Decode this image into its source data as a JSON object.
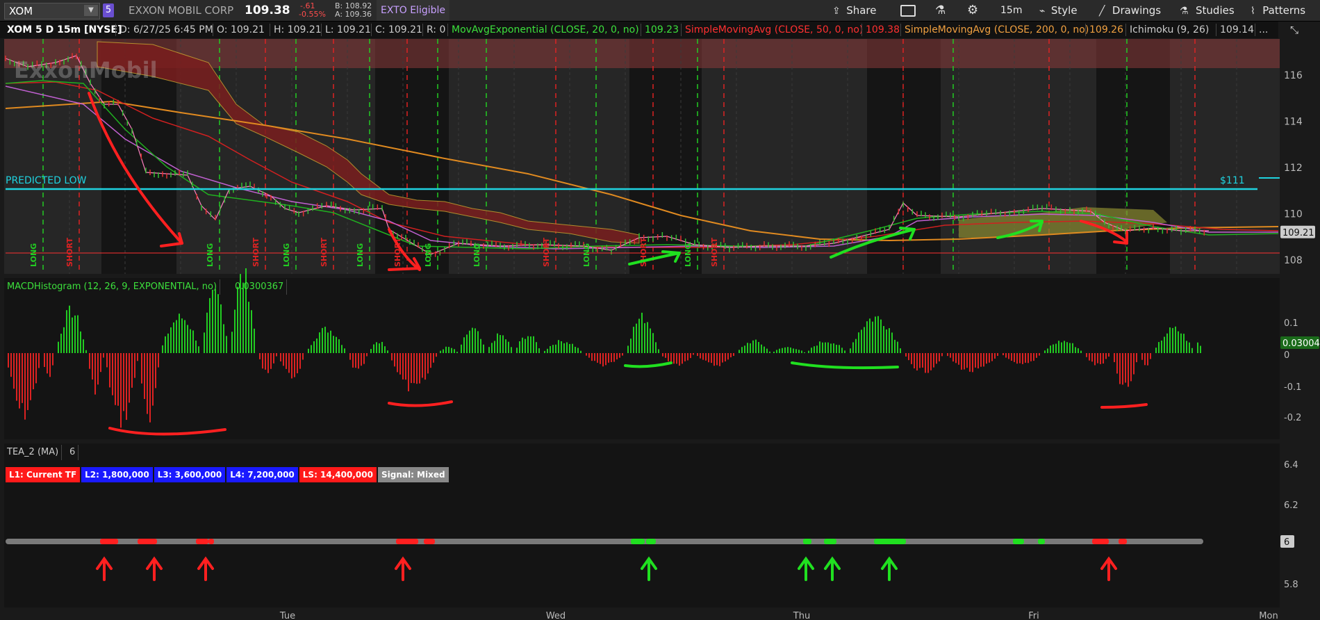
{
  "toolbar": {
    "symbol": "XOM",
    "badge": "5",
    "company": "EXXON MOBIL CORP",
    "last": "109.38",
    "change": "-.61",
    "change_pct": "-0.55%",
    "bid": "B: 108.92",
    "ask": "A: 109.36",
    "eligible": "EXTO Eligible",
    "share": "Share",
    "interval": "15m",
    "style": "Style",
    "drawings": "Drawings",
    "studies": "Studies",
    "patterns": "Patterns"
  },
  "status": {
    "title": "XOM 5 D 15m [NYSE]",
    "date": "D: 6/27/25 6:45 PM",
    "open": "O: 109.21",
    "high": "H: 109.21",
    "low": "L: 109.21",
    "close": "C: 109.21",
    "range": "R: 0",
    "ema": "MovAvgExponential (CLOSE, 20, 0, no)",
    "ema_val": "109.23",
    "sma50": "SimpleMovingAvg (CLOSE, 50, 0, no)",
    "sma50_val": "109.38",
    "sma200": "SimpleMovingAvg (CLOSE, 200, 0, no)",
    "sma200_val": "109.26",
    "ichimoku": "Ichimoku (9, 26)",
    "ichimoku_val": "109.14",
    "more": "..."
  },
  "price_pane": {
    "y_ticks": [
      "116",
      "114",
      "112",
      "110",
      "108"
    ],
    "current_price": "109.21",
    "predicted_label": "PREDICTED LOW",
    "predicted_price": "$111",
    "watermark": "ExxonMobil",
    "signals": [
      {
        "label": "LONG",
        "color": "#22cc22"
      },
      {
        "label": "SHORT",
        "color": "#dd2222"
      },
      {
        "label": "LONG",
        "color": "#22cc22"
      },
      {
        "label": "SHORT",
        "color": "#dd2222"
      },
      {
        "label": "LONG",
        "color": "#22cc22"
      },
      {
        "label": "SHORT",
        "color": "#dd2222"
      },
      {
        "label": "LONG",
        "color": "#22cc22"
      },
      {
        "label": "SHORT",
        "color": "#dd2222"
      },
      {
        "label": "LONG",
        "color": "#22cc22"
      },
      {
        "label": "LONG",
        "color": "#22cc22"
      },
      {
        "label": "SHORT",
        "color": "#dd2222"
      },
      {
        "label": "LONG",
        "color": "#22cc22"
      },
      {
        "label": "SHORT",
        "color": "#dd2222"
      },
      {
        "label": "LONG",
        "color": "#22cc22"
      },
      {
        "label": "SHORT",
        "color": "#dd2222"
      }
    ]
  },
  "macd_pane": {
    "title": "MACDHistogram (12, 26, 9, EXPONENTIAL, no)",
    "value": "0.0300367",
    "y_ticks": [
      "0.1",
      "0",
      "-0.1",
      "-0.2"
    ],
    "current_value": "0.03004"
  },
  "tea_pane": {
    "title": "TEA_2 (MA)",
    "value": "6",
    "legend": [
      {
        "label": "L1: Current TF",
        "bg": "#ff1a1a",
        "fg": "#ffffff"
      },
      {
        "label": "L2: 1,800,000",
        "bg": "#1a1aff",
        "fg": "#ffffff"
      },
      {
        "label": "L3: 3,600,000",
        "bg": "#1a1aff",
        "fg": "#ffffff"
      },
      {
        "label": "L4: 7,200,000",
        "bg": "#1a1aff",
        "fg": "#ffffff"
      },
      {
        "label": "LS: 14,400,000",
        "bg": "#ff1a1a",
        "fg": "#ffffff"
      },
      {
        "label": "Signal: Mixed",
        "bg": "#888888",
        "fg": "#ffffff"
      }
    ],
    "y_ticks": [
      "6.4",
      "6.2",
      "5.8"
    ],
    "current_value": "6"
  },
  "x_axis": {
    "labels": [
      "Tue",
      "Wed",
      "Thu",
      "Fri",
      "Mon"
    ]
  }
}
